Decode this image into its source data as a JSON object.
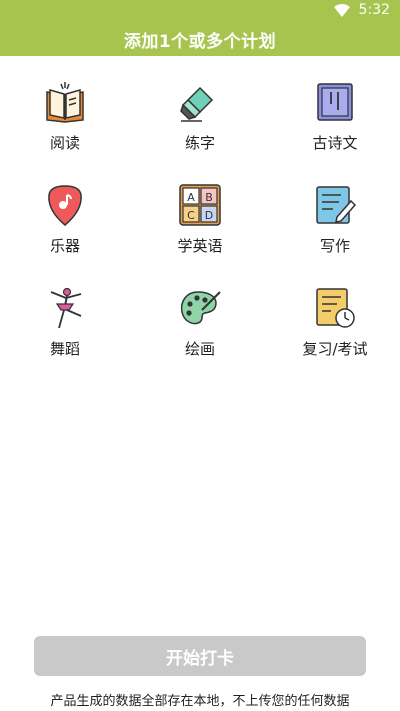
{
  "status_bar": {
    "time": "5:32"
  },
  "header": {
    "title": "添加1个或多个计划"
  },
  "plans": [
    {
      "label": "阅读",
      "icon": "open-book-icon"
    },
    {
      "label": "练字",
      "icon": "marker-pen-icon"
    },
    {
      "label": "古诗文",
      "icon": "poetry-scroll-icon"
    },
    {
      "label": "乐器",
      "icon": "guitar-pick-icon"
    },
    {
      "label": "学英语",
      "icon": "abcd-blocks-icon"
    },
    {
      "label": "写作",
      "icon": "writing-note-icon"
    },
    {
      "label": "舞蹈",
      "icon": "dancer-icon"
    },
    {
      "label": "绘画",
      "icon": "paint-palette-icon"
    },
    {
      "label": "复习/考试",
      "icon": "study-clock-icon"
    }
  ],
  "start_button": {
    "label": "开始打卡"
  },
  "footer": {
    "note": "产品生成的数据全部存在本地，不上传您的任何数据"
  },
  "colors": {
    "accent": "#a7c44f",
    "button_disabled": "#c9c9c9"
  }
}
